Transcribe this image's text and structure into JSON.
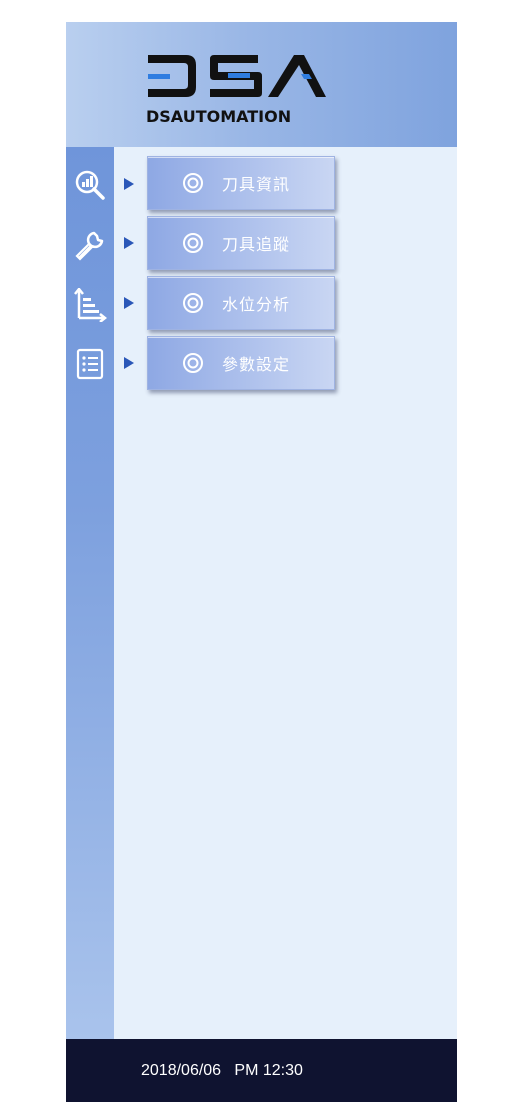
{
  "brand": {
    "logo_text": "DSA",
    "tagline": "DSAUTOMATION",
    "accent_color": "#2f7de1"
  },
  "sidebar": {
    "icons": [
      {
        "name": "analytics-search-icon"
      },
      {
        "name": "wrench-icon"
      },
      {
        "name": "bar-chart-icon"
      },
      {
        "name": "checklist-icon"
      }
    ]
  },
  "menu": {
    "items": [
      {
        "label": "刀具資訊",
        "icon": "target-ring-icon"
      },
      {
        "label": "刀具追蹤",
        "icon": "target-ring-icon"
      },
      {
        "label": "水位分析",
        "icon": "target-ring-icon"
      },
      {
        "label": "參數設定",
        "icon": "target-ring-icon"
      }
    ]
  },
  "footer": {
    "datetime": "2018/06/06   PM 12:30"
  },
  "colors": {
    "sidebar": "#7da0de",
    "content_bg": "#e6f0fb",
    "footer_bg": "#0f1330",
    "arrow": "#2a57b8"
  }
}
